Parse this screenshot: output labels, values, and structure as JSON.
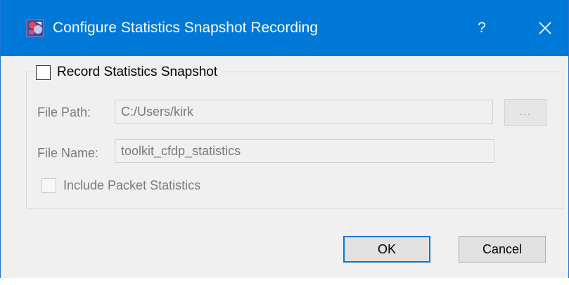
{
  "titlebar": {
    "title": "Configure Statistics Snapshot Recording",
    "help_label": "?",
    "app_icon": "app-icon",
    "close_icon": "close-icon"
  },
  "group": {
    "checkbox_label": "Record Statistics Snapshot",
    "checked": false
  },
  "file_path": {
    "label": "File Path:",
    "value": "C:/Users/kirk",
    "browse_label": "..."
  },
  "file_name": {
    "label": "File Name:",
    "value": "toolkit_cfdp_statistics"
  },
  "include_packet": {
    "label": "Include Packet Statistics",
    "checked": false
  },
  "buttons": {
    "ok": "OK",
    "cancel": "Cancel"
  },
  "colors": {
    "titlebar": "#0078d7",
    "dialog_bg": "#f0f0f0",
    "default_button_border": "#0078d7"
  }
}
